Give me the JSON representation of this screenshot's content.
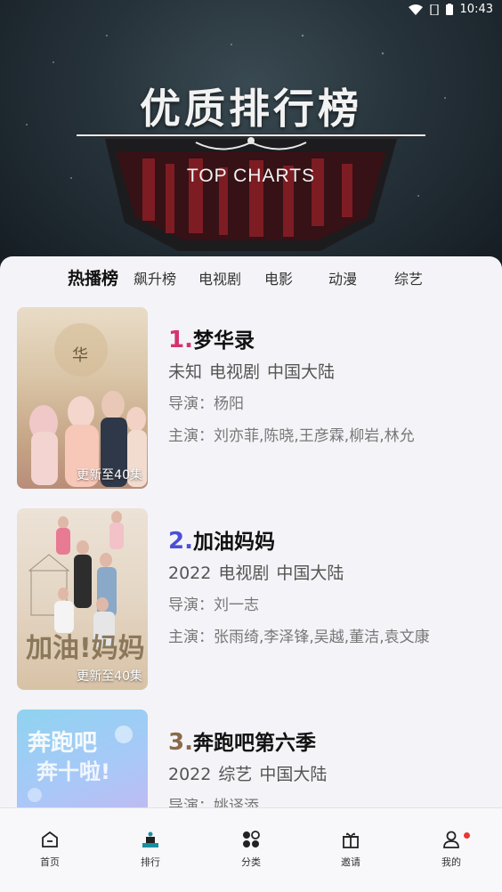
{
  "status_bar": {
    "time": "10:43",
    "icons": [
      "wifi-icon",
      "sim-icon",
      "battery-icon"
    ]
  },
  "hero": {
    "title": "优质排行榜",
    "subtitle": "TOP CHARTS"
  },
  "tabs": [
    {
      "label": "热播榜",
      "active": true
    },
    {
      "label": "飙升榜",
      "active": false
    },
    {
      "label": "电视剧",
      "active": false
    },
    {
      "label": "电影",
      "active": false
    },
    {
      "label": "动漫",
      "active": false
    },
    {
      "label": "综艺",
      "active": false
    }
  ],
  "items": [
    {
      "rank": "1.",
      "rank_color": "#d6336c",
      "title": "梦华录",
      "year": "未知",
      "category": "电视剧",
      "region": "中国大陆",
      "director": "导演：杨阳",
      "cast": "主演：刘亦菲,陈晓,王彦霖,柳岩,林允",
      "badge": "更新至40集"
    },
    {
      "rank": "2.",
      "rank_color": "#4c4fd6",
      "title": "加油妈妈",
      "year": "2022",
      "category": "电视剧",
      "region": "中国大陆",
      "director": "导演：刘一志",
      "cast": "主演：张雨绮,李泽锋,吴越,董洁,袁文康",
      "badge": "更新至40集",
      "poster_text": "加油!妈妈"
    },
    {
      "rank": "3.",
      "rank_color": "#8a6a4a",
      "title": "奔跑吧第六季",
      "year": "2022",
      "category": "综艺",
      "region": "中国大陆",
      "director": "导演：姚译添",
      "cast": "",
      "badge": ""
    }
  ],
  "nav": [
    {
      "label": "首页",
      "icon": "home-icon",
      "active": false
    },
    {
      "label": "排行",
      "icon": "ranking-icon",
      "active": true
    },
    {
      "label": "分类",
      "icon": "category-icon",
      "active": false
    },
    {
      "label": "邀请",
      "icon": "gift-icon",
      "active": false
    },
    {
      "label": "我的",
      "icon": "user-icon",
      "active": false,
      "notification": true
    }
  ]
}
